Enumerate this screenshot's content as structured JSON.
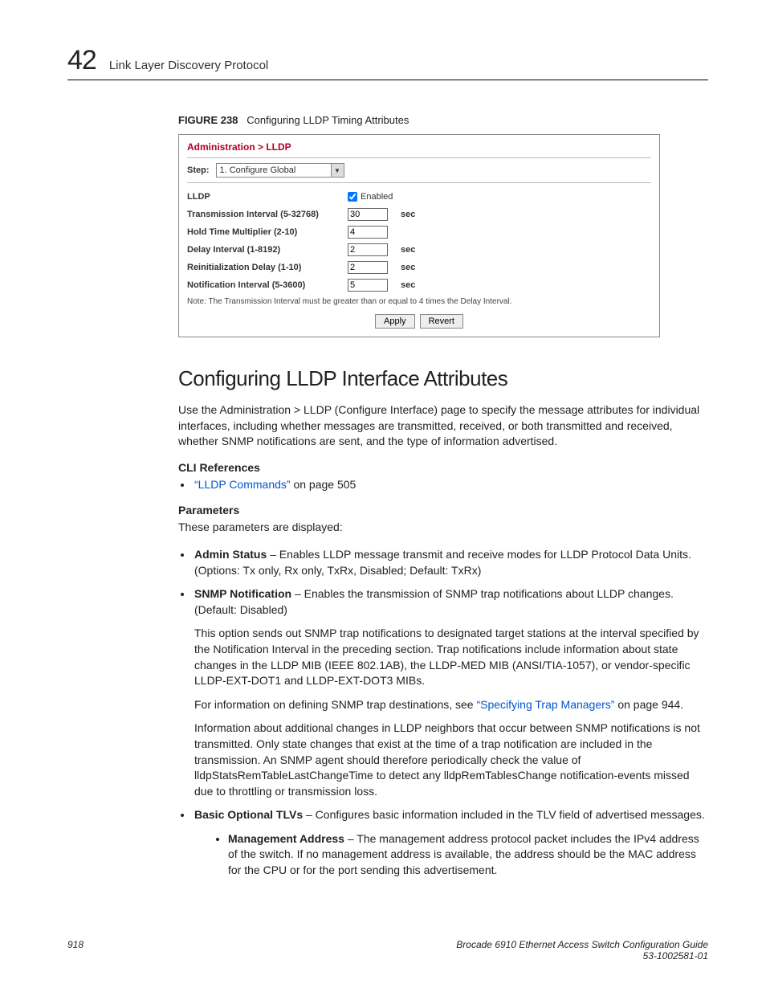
{
  "header": {
    "chapter_num": "42",
    "chapter_title": "Link Layer Discovery Protocol"
  },
  "figure": {
    "num": "FIGURE 238",
    "caption": "Configuring LLDP Timing Attributes"
  },
  "panel": {
    "breadcrumb": "Administration > LLDP",
    "step_label": "Step:",
    "step_value": "1. Configure Global",
    "rows": {
      "lldp_label": "LLDP",
      "enabled_label": "Enabled",
      "tx_label": "Transmission Interval (5-32768)",
      "tx_value": "30",
      "hold_label": "Hold Time Multiplier (2-10)",
      "hold_value": "4",
      "delay_label": "Delay Interval (1-8192)",
      "delay_value": "2",
      "reinit_label": "Reinitialization Delay (1-10)",
      "reinit_value": "2",
      "notif_label": "Notification Interval (5-3600)",
      "notif_value": "5",
      "sec": "sec"
    },
    "note": "Note: The Transmission Interval must be greater than or equal to 4 times the Delay Interval.",
    "apply": "Apply",
    "revert": "Revert"
  },
  "section_heading": "Configuring LLDP Interface Attributes",
  "intro": "Use the Administration > LLDP (Configure Interface) page to specify the message attributes for individual interfaces, including whether messages are transmitted, received, or both transmitted and received, whether SNMP notifications are sent, and the type of information advertised.",
  "cli_refs_head": "CLI References",
  "cli_link": "“LLDP Commands”",
  "cli_link_after": " on page 505",
  "params_head": "Parameters",
  "params_intro": "These parameters are displayed:",
  "bul": {
    "admin_term": "Admin Status",
    "admin_text": " – Enables LLDP message transmit and receive modes for LLDP Protocol Data Units. (Options: Tx only, Rx only, TxRx, Disabled; Default: TxRx)",
    "snmp_term": "SNMP Notification",
    "snmp_text": " – Enables the transmission of SNMP trap notifications about LLDP changes. (Default: Disabled)",
    "snmp_p2": "This option sends out SNMP trap notifications to designated target stations at the interval specified by the Notification Interval in the preceding section. Trap notifications include information about state changes in the LLDP MIB (IEEE 802.1AB), the LLDP-MED MIB (ANSI/TIA-1057), or vendor-specific LLDP-EXT-DOT1 and LLDP-EXT-DOT3 MIBs.",
    "snmp_p3_pre": "For information on defining SNMP trap destinations, see ",
    "snmp_p3_link": "“Specifying Trap Managers”",
    "snmp_p3_post": " on page 944.",
    "snmp_p4": "Information about additional changes in LLDP neighbors that occur between SNMP notifications is not transmitted. Only state changes that exist at the time of a trap notification are included in the transmission. An SNMP agent should therefore periodically check the value of lldpStatsRemTableLastChangeTime to detect any lldpRemTablesChange notification-events missed due to throttling or transmission loss.",
    "tlv_term": "Basic Optional TLVs",
    "tlv_text": " – Configures basic information included in the TLV field of advertised messages.",
    "mgmt_term": "Management Address",
    "mgmt_text": " – The management address protocol packet includes the IPv4 address of the switch. If no management address is available, the address should be the MAC address for the CPU or for the port sending this advertisement."
  },
  "footer": {
    "page": "918",
    "doc_title": "Brocade 6910 Ethernet Access Switch Configuration Guide",
    "doc_num": "53-1002581-01"
  }
}
